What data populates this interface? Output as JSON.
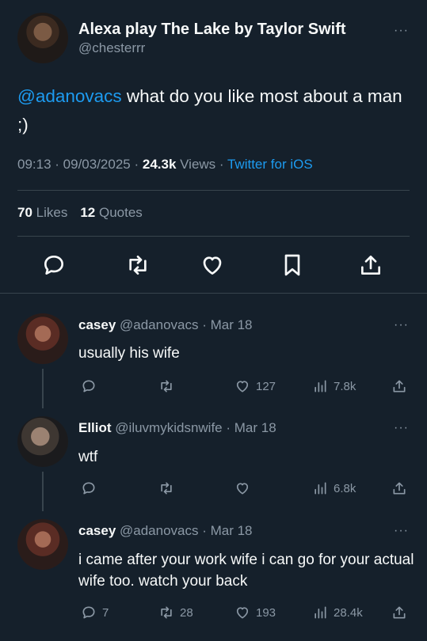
{
  "main_tweet": {
    "display_name": "Alexa play The Lake by Taylor Swift",
    "handle": "@chesterrr",
    "mention": "@adanovacs",
    "body": " what do you like most about a man ;)",
    "time": "09:13",
    "sep1": " · ",
    "date": "09/03/2025",
    "sep2": " · ",
    "views_count": "24.3k",
    "views_label": " Views",
    "sep3": " · ",
    "source": "Twitter for iOS",
    "likes_count": "70",
    "likes_label": " Likes",
    "quotes_count": "12",
    "quotes_label": " Quotes"
  },
  "more_glyph": "···",
  "replies": [
    {
      "name": "casey",
      "handle": " @adanovacs",
      "date": " · Mar 18",
      "text": "usually his wife",
      "replies": "",
      "retweets": "",
      "likes": "127",
      "views": "7.8k"
    },
    {
      "name": "Elliot",
      "handle": " @iluvmykidsnwife",
      "date": " · Mar 18",
      "text": "wtf",
      "replies": "",
      "retweets": "",
      "likes": "",
      "views": "6.8k"
    },
    {
      "name": "casey",
      "handle": " @adanovacs",
      "date": " · Mar 18",
      "text": "i came after your work wife i can go for your actual wife too. watch your back",
      "replies": "7",
      "retweets": "28",
      "likes": "193",
      "views": "28.4k"
    }
  ],
  "icons": {
    "reply": "reply-icon",
    "retweet": "retweet-icon",
    "like": "heart-icon",
    "bookmark": "bookmark-icon",
    "share": "share-icon",
    "views": "views-icon",
    "more": "more-icon"
  },
  "colors": {
    "background": "#15202b",
    "text": "#f7f9f9",
    "muted": "#8b98a5",
    "link": "#1d9bf0",
    "divider": "#38444d"
  }
}
